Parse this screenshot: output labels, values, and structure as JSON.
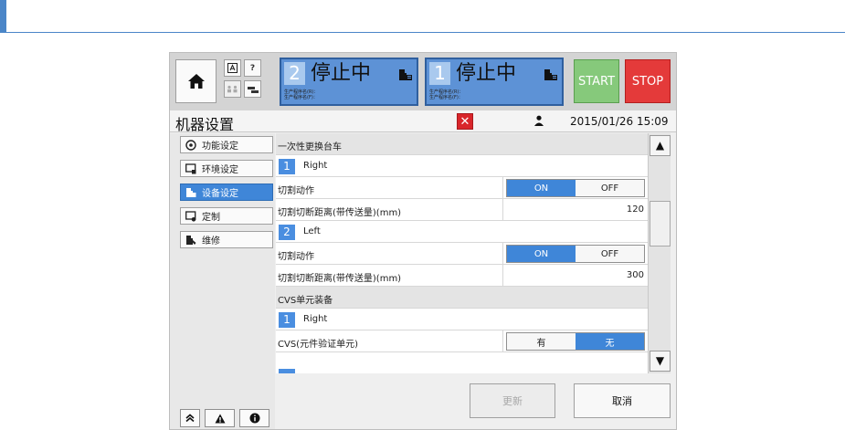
{
  "header": {
    "home_icon": "home-icon",
    "manual_icon": "manual-icon",
    "help_label": "?",
    "operator_icon": "operator-icon",
    "network_icon": "network-icon",
    "lanes": [
      {
        "number": "2",
        "state": "停止中",
        "program_lines": [
          "生产程序名(R)：",
          "生产程序名(F)："
        ]
      },
      {
        "number": "1",
        "state": "停止中",
        "program_lines": [
          "生产程序名(R)：",
          "生产程序名(F)："
        ]
      }
    ],
    "start_label": "START",
    "stop_label": "STOP"
  },
  "title_bar": {
    "title": "机器设置",
    "datetime": "2015/01/26 15:09"
  },
  "sidebar": {
    "items": [
      {
        "label": "功能设定",
        "icon": "function-settings-icon",
        "active": false
      },
      {
        "label": "环境设定",
        "icon": "environment-settings-icon",
        "active": false
      },
      {
        "label": "设备设定",
        "icon": "equipment-settings-icon",
        "active": true
      },
      {
        "label": "定制",
        "icon": "customize-icon",
        "active": false
      },
      {
        "label": "维修",
        "icon": "maintenance-icon",
        "active": false
      }
    ],
    "bottom_icons": [
      "collapse-icon",
      "warning-icon",
      "info-icon"
    ]
  },
  "list": {
    "rows": [
      {
        "type": "section",
        "label": "一次性更换台车"
      },
      {
        "type": "lane",
        "number": "1",
        "name": "Right"
      },
      {
        "type": "toggle",
        "label": "切割动作",
        "options": [
          "ON",
          "OFF"
        ],
        "selected": "ON"
      },
      {
        "type": "value",
        "label": "切割切断距离(带传送量)(mm)",
        "value": "120"
      },
      {
        "type": "lane",
        "number": "2",
        "name": "Left"
      },
      {
        "type": "toggle",
        "label": "切割动作",
        "options": [
          "ON",
          "OFF"
        ],
        "selected": "ON"
      },
      {
        "type": "value",
        "label": "切割切断距离(带传送量)(mm)",
        "value": "300"
      },
      {
        "type": "section",
        "label": "CVS单元装备"
      },
      {
        "type": "lane",
        "number": "1",
        "name": "Right"
      },
      {
        "type": "toggle",
        "label": "CVS(元件验证单元)",
        "options": [
          "有",
          "无"
        ],
        "selected": "无"
      }
    ]
  },
  "actions": {
    "update_label": "更新",
    "cancel_label": "取消"
  },
  "colors": {
    "accent_blue": "#3f86d8",
    "start_green": "#86c97b",
    "stop_red": "#e43a3a",
    "close_red": "#d9262b"
  }
}
